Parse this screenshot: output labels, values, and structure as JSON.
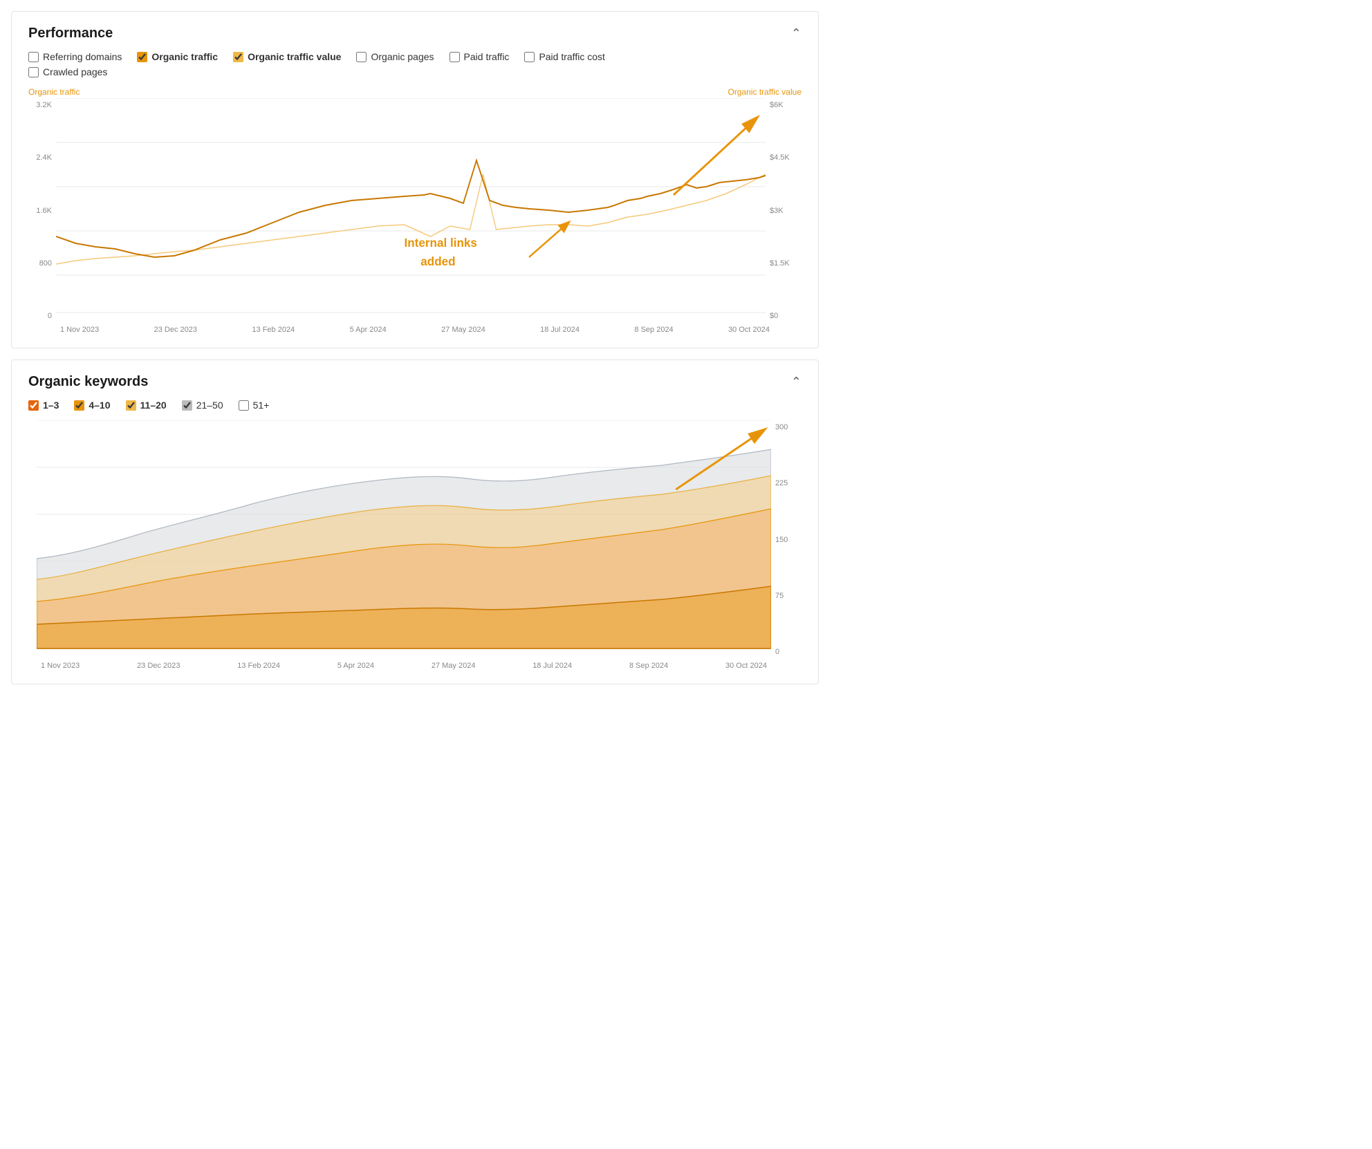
{
  "performance": {
    "title": "Performance",
    "checkboxes": [
      {
        "id": "referring_domains",
        "label": "Referring domains",
        "checked": false,
        "color": "#aaa"
      },
      {
        "id": "organic_traffic",
        "label": "Organic traffic",
        "checked": true,
        "color": "#e8940a"
      },
      {
        "id": "organic_traffic_value",
        "label": "Organic traffic value",
        "checked": true,
        "color": "#f0b84a"
      },
      {
        "id": "organic_pages",
        "label": "Organic pages",
        "checked": false,
        "color": "#aaa"
      },
      {
        "id": "paid_traffic",
        "label": "Paid traffic",
        "checked": false,
        "color": "#aaa"
      },
      {
        "id": "paid_traffic_cost",
        "label": "Paid traffic cost",
        "checked": false,
        "color": "#aaa"
      }
    ],
    "checkboxes_row2": [
      {
        "id": "crawled_pages",
        "label": "Crawled pages",
        "checked": false,
        "color": "#aaa"
      }
    ],
    "left_axis_label": "Organic traffic",
    "right_axis_label": "Organic traffic value",
    "y_left_labels": [
      "3.2K",
      "2.4K",
      "1.6K",
      "800",
      "0"
    ],
    "y_right_labels": [
      "$6K",
      "$4.5K",
      "$3K",
      "$1.5K",
      "$0"
    ],
    "x_labels": [
      "1 Nov 2023",
      "23 Dec 2023",
      "13 Feb 2024",
      "5 Apr 2024",
      "27 May 2024",
      "18 Jul 2024",
      "8 Sep 2024",
      "30 Oct 2024"
    ],
    "annotation": "Internal links\nadded"
  },
  "organic_keywords": {
    "title": "Organic keywords",
    "checkboxes": [
      {
        "id": "kw_1_3",
        "label": "1–3",
        "checked": true,
        "color": "#e8640a"
      },
      {
        "id": "kw_4_10",
        "label": "4–10",
        "checked": true,
        "color": "#e8940a"
      },
      {
        "id": "kw_11_20",
        "label": "11–20",
        "checked": true,
        "color": "#f0b84a"
      },
      {
        "id": "kw_21_50",
        "label": "21–50",
        "checked": true,
        "color": "#ccc"
      },
      {
        "id": "kw_51plus",
        "label": "51+",
        "checked": false,
        "color": "#aaa"
      }
    ],
    "y_right_labels": [
      "300",
      "225",
      "150",
      "75",
      "0"
    ],
    "x_labels": [
      "1 Nov 2023",
      "23 Dec 2023",
      "13 Feb 2024",
      "5 Apr 2024",
      "27 May 2024",
      "18 Jul 2024",
      "8 Sep 2024",
      "30 Oct 2024"
    ]
  }
}
